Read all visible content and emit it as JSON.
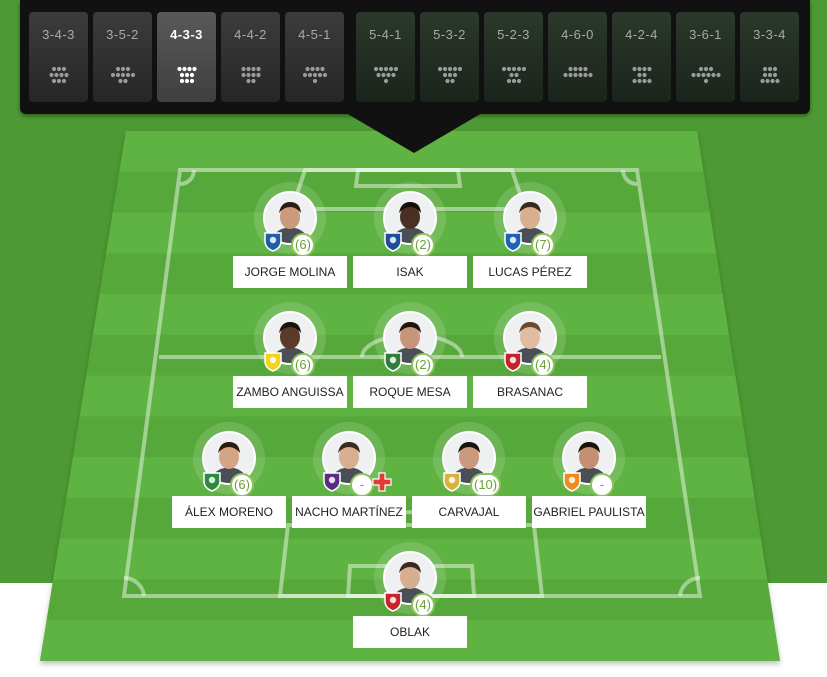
{
  "formations": [
    {
      "label": "3-4-3",
      "rows": [
        3,
        4,
        3
      ],
      "state": "normal"
    },
    {
      "label": "3-5-2",
      "rows": [
        3,
        5,
        2
      ],
      "state": "normal"
    },
    {
      "label": "4-3-3",
      "rows": [
        4,
        3,
        3
      ],
      "state": "active"
    },
    {
      "label": "4-4-2",
      "rows": [
        4,
        4,
        2
      ],
      "state": "normal"
    },
    {
      "label": "4-5-1",
      "rows": [
        4,
        5,
        1
      ],
      "state": "normal"
    },
    {
      "label": "5-4-1",
      "rows": [
        5,
        4,
        1
      ],
      "state": "alt"
    },
    {
      "label": "5-3-2",
      "rows": [
        5,
        3,
        2
      ],
      "state": "alt"
    },
    {
      "label": "5-2-3",
      "rows": [
        5,
        2,
        3
      ],
      "state": "alt"
    },
    {
      "label": "4-6-0",
      "rows": [
        4,
        6,
        0
      ],
      "state": "alt"
    },
    {
      "label": "4-2-4",
      "rows": [
        4,
        2,
        4
      ],
      "state": "alt"
    },
    {
      "label": "3-6-1",
      "rows": [
        3,
        6,
        1
      ],
      "state": "alt"
    },
    {
      "label": "3-3-4",
      "rows": [
        3,
        3,
        4
      ],
      "state": "alt"
    }
  ],
  "players": [
    {
      "name": "JORGE MOLINA",
      "points": "(6)",
      "club": "getafe",
      "badge_color": "#1f5fa8",
      "skin": "#c99b78",
      "hair": "#2a1d15",
      "injured": false
    },
    {
      "name": "ISAK",
      "points": "(2)",
      "club": "real-sociedad",
      "badge_color": "#1c4d9c",
      "skin": "#4a2f22",
      "hair": "#160d08",
      "injured": false
    },
    {
      "name": "LUCAS PÉREZ",
      "points": "(7)",
      "club": "alaves",
      "badge_color": "#1d62b5",
      "skin": "#d9b08f",
      "hair": "#3a2a1e",
      "injured": false
    },
    {
      "name": "ZAMBO ANGUISSA",
      "points": "(6)",
      "club": "villarreal",
      "badge_color": "#f2d21a",
      "skin": "#5a3a28",
      "hair": "#1a120c",
      "injured": false
    },
    {
      "name": "ROQUE MESA",
      "points": "(2)",
      "club": "leganes",
      "badge_color": "#2e7d3b",
      "skin": "#c8957a",
      "hair": "#201510",
      "injured": false
    },
    {
      "name": "BRASANAC",
      "points": "(4)",
      "club": "osasuna",
      "badge_color": "#c4212b",
      "skin": "#e2bca0",
      "hair": "#6b4a2e",
      "injured": false
    },
    {
      "name": "ÁLEX MORENO",
      "points": "(6)",
      "club": "betis",
      "badge_color": "#2b8a3e",
      "skin": "#d3a585",
      "hair": "#2a1c14",
      "injured": false
    },
    {
      "name": "NACHO MARTÍNEZ",
      "points": "-",
      "club": "valladolid",
      "badge_color": "#5b2c84",
      "skin": "#d8af92",
      "hair": "#3b2b20",
      "injured": true
    },
    {
      "name": "CARVAJAL",
      "points": "(10)",
      "club": "real-madrid",
      "badge_color": "#d8b23a",
      "skin": "#c99a7c",
      "hair": "#1b130d",
      "injured": false
    },
    {
      "name": "GABRIEL PAULISTA",
      "points": "-",
      "club": "valencia",
      "badge_color": "#f08a1c",
      "skin": "#c39072",
      "hair": "#1a120b",
      "injured": false
    },
    {
      "name": "OBLAK",
      "points": "(4)",
      "club": "atletico",
      "badge_color": "#c8232c",
      "skin": "#d8ae90",
      "hair": "#3a2a1d",
      "injured": false
    }
  ],
  "colors": {
    "pitch_light": "#5fb342",
    "pitch_dark": "#56a83a",
    "toolbar_bg": "#111111",
    "points_accent": "#8cc35b",
    "injury": "#e53935"
  },
  "icons": [
    "formation-dots-icon",
    "club-badge-icon",
    "player-photo",
    "injury-cross-icon"
  ]
}
